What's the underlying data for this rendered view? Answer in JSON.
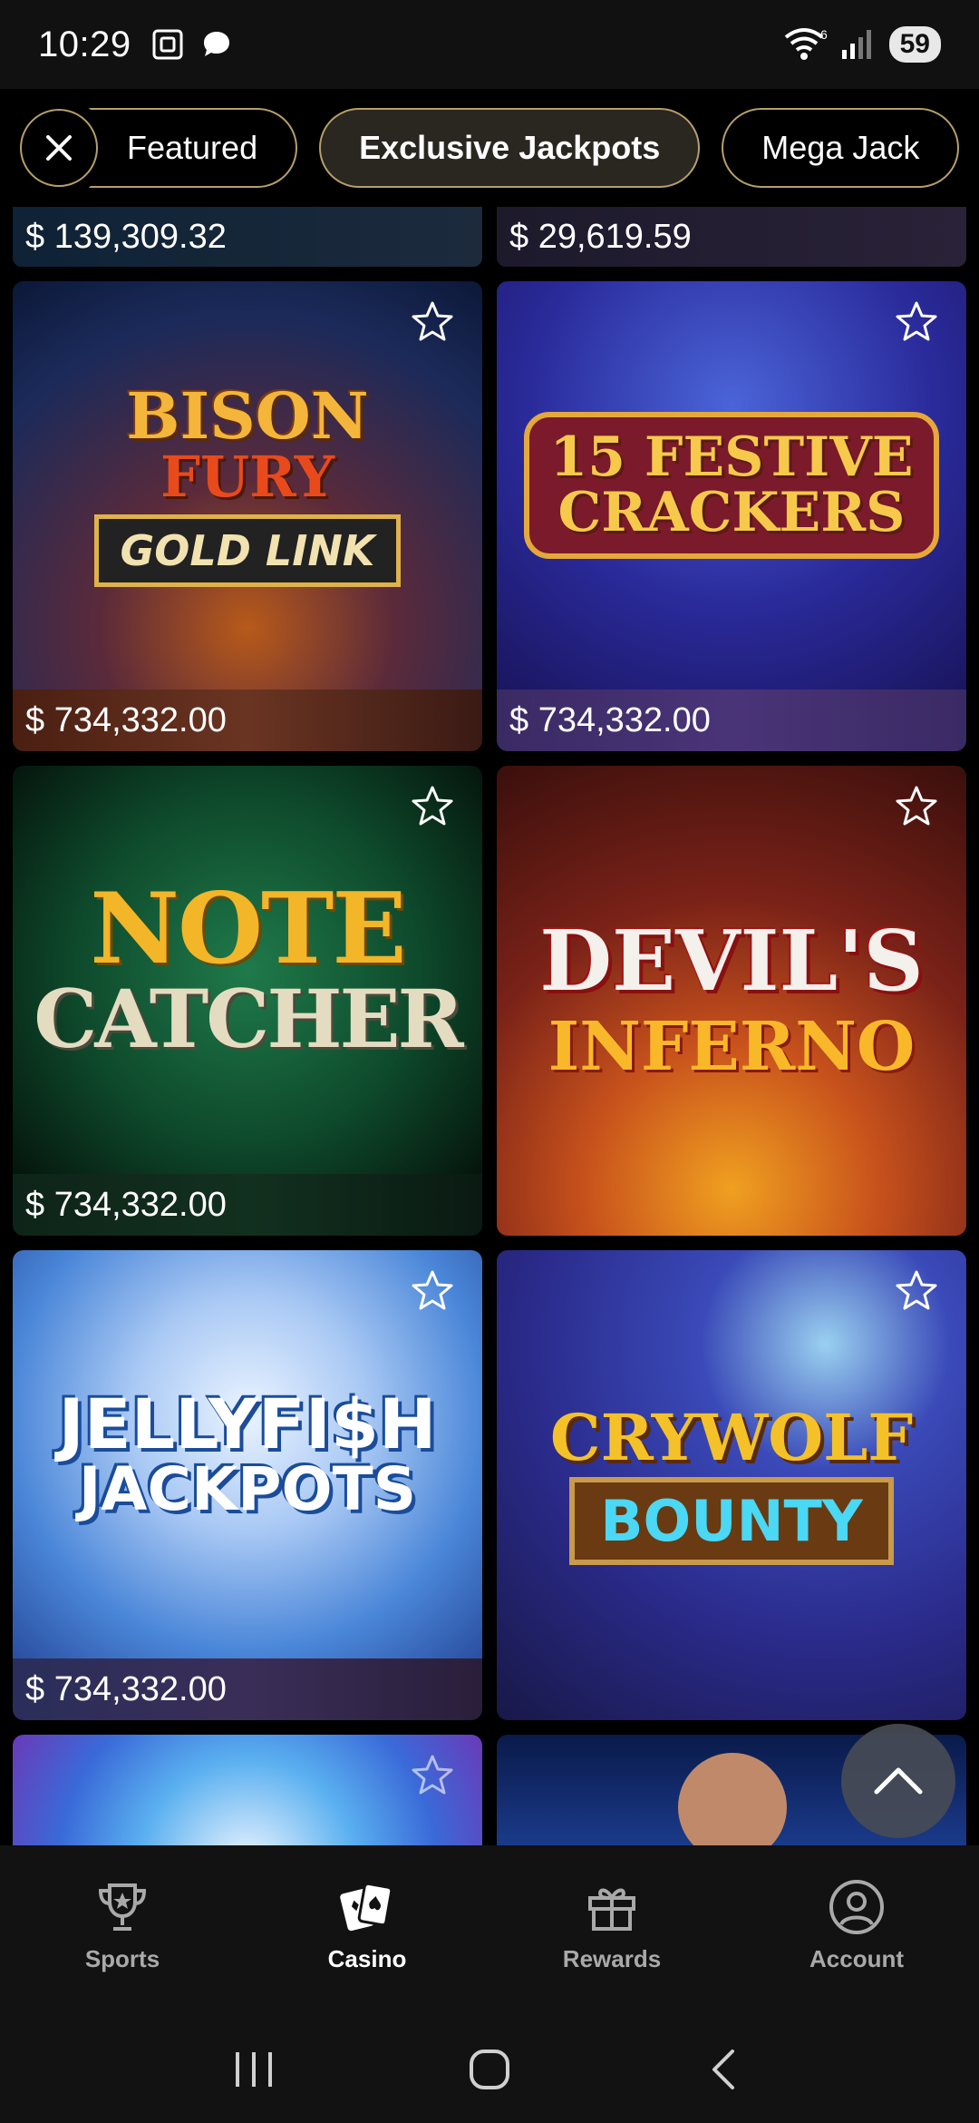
{
  "status_bar": {
    "time": "10:29",
    "wifi_label": "6",
    "battery": "59"
  },
  "filters": {
    "close_icon": "close-icon",
    "chips": [
      {
        "label": "Featured",
        "active": false
      },
      {
        "label": "Exclusive Jackpots",
        "active": true
      },
      {
        "label": "Mega Jack",
        "active": false
      }
    ]
  },
  "games": {
    "top_row": [
      {
        "jackpot": "$ 139,309.32"
      },
      {
        "jackpot": "$ 29,619.59"
      }
    ],
    "cards": [
      {
        "title_lines": [
          "BISON",
          "FURY",
          "GOLD LINK"
        ],
        "jackpot": "$ 734,332.00"
      },
      {
        "title_lines": [
          "15 FESTIVE",
          "CRACKERS"
        ],
        "jackpot": "$ 734,332.00"
      },
      {
        "title_lines": [
          "NOTE",
          "CATCHER"
        ],
        "jackpot": "$ 734,332.00"
      },
      {
        "title_lines": [
          "DEVIL'S",
          "INFERNO"
        ],
        "jackpot": ""
      },
      {
        "title_lines": [
          "JELLYFI$H",
          "JACKPOTS"
        ],
        "jackpot": "$ 734,332.00"
      },
      {
        "title_lines": [
          "CRYWOLF",
          "BOUNTY"
        ],
        "jackpot": ""
      }
    ]
  },
  "bottom_nav": {
    "items": [
      {
        "label": "Sports",
        "icon": "trophy-icon",
        "active": false
      },
      {
        "label": "Casino",
        "icon": "cards-icon",
        "active": true
      },
      {
        "label": "Rewards",
        "icon": "gift-icon",
        "active": false
      },
      {
        "label": "Account",
        "icon": "account-icon",
        "active": false
      }
    ]
  },
  "colors": {
    "accent_gold": "#b79f6a",
    "nav_bg": "#121212"
  }
}
